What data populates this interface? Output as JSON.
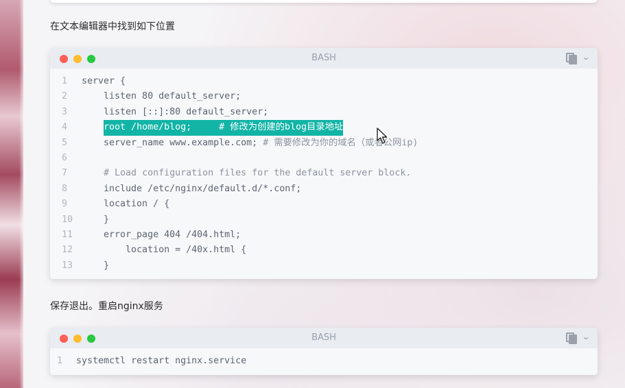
{
  "para1": "在文本编辑器中找到如下位置",
  "para2": "保存退出。重启nginx服务",
  "block1": {
    "lang": "BASH",
    "lines": [
      {
        "n": "1",
        "code": "server {",
        "comment": ""
      },
      {
        "n": "2",
        "code": "    listen 80 default_server;",
        "comment": ""
      },
      {
        "n": "3",
        "code": "    listen [::]:80 default_server;",
        "comment": ""
      },
      {
        "n": "4",
        "code": "    root /home/blog;     ",
        "comment": "# 修改为创建的blog目录地址"
      },
      {
        "n": "5",
        "code": "    server_name www.example.com; ",
        "comment": "# 需要修改为你的域名（或者公网ip)"
      },
      {
        "n": "6",
        "code": "",
        "comment": ""
      },
      {
        "n": "7",
        "code": "    ",
        "comment": "# Load configuration files for the default server block."
      },
      {
        "n": "8",
        "code": "    include /etc/nginx/default.d/*.conf;",
        "comment": ""
      },
      {
        "n": "9",
        "code": "    location / {",
        "comment": ""
      },
      {
        "n": "10",
        "code": "    }",
        "comment": ""
      },
      {
        "n": "11",
        "code": "    error_page 404 /404.html;",
        "comment": ""
      },
      {
        "n": "12",
        "code": "        location = /40x.html {",
        "comment": ""
      },
      {
        "n": "13",
        "code": "    }",
        "comment": ""
      }
    ]
  },
  "block2": {
    "lang": "BASH",
    "lines": [
      {
        "n": "1",
        "code": "systemctl restart nginx.service",
        "comment": ""
      }
    ]
  },
  "icons": {
    "copy": "copy-icon",
    "chevron": "chevron-down-icon",
    "cursor": "mouse-pointer-icon"
  },
  "colors": {
    "highlight": "#12b4a6",
    "dot_red": "#ff5f56",
    "dot_yellow": "#ffbd2e",
    "dot_green": "#27c93f"
  }
}
